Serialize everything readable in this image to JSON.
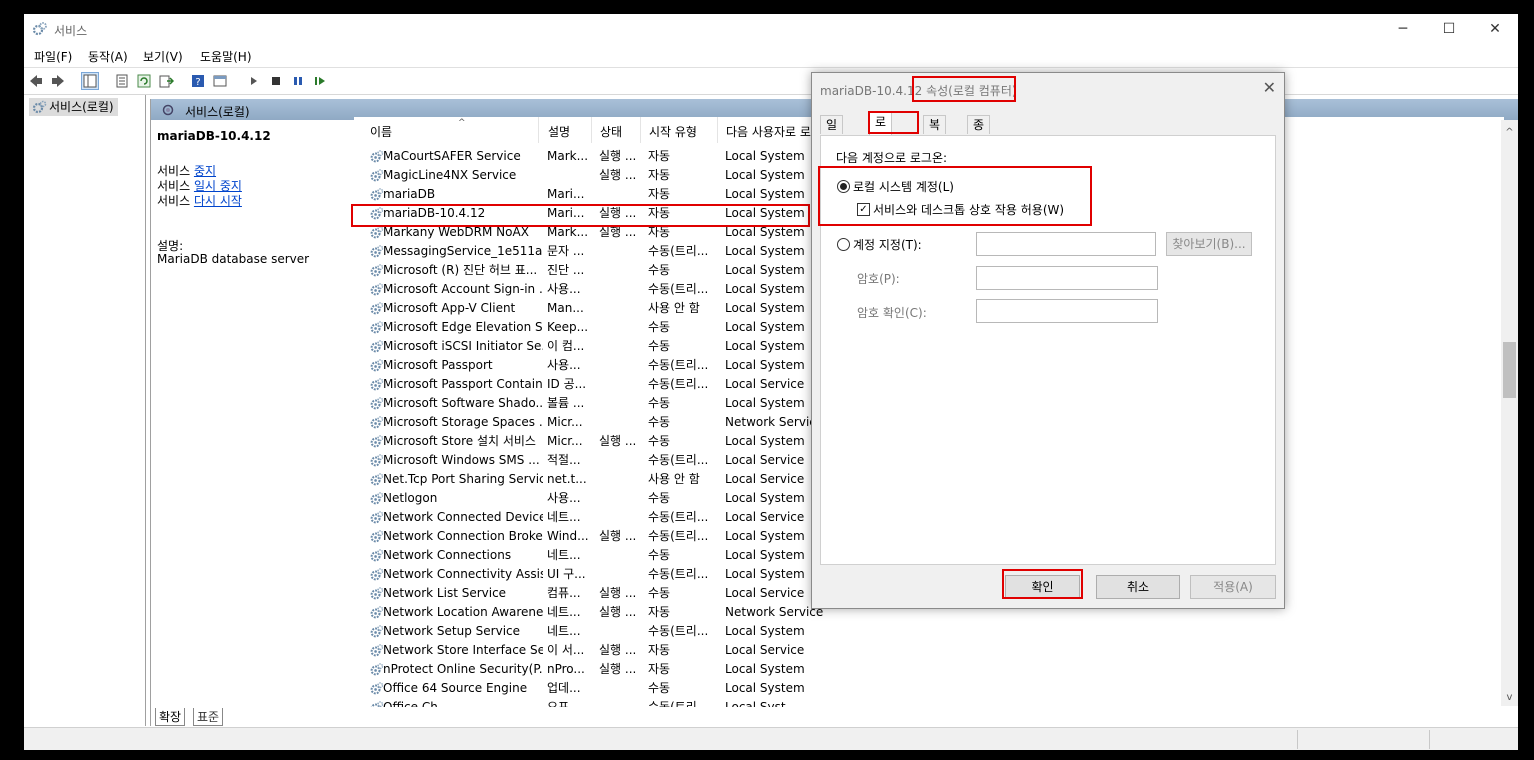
{
  "window": {
    "title": "서비스",
    "min": "─",
    "max": "☐",
    "close": "✕"
  },
  "menu": [
    "파일(F)",
    "동작(A)",
    "보기(V)",
    "도움말(H)"
  ],
  "tree": {
    "root": "서비스(로컬)"
  },
  "pane": {
    "header": "서비스(로컬)",
    "selected_name": "mariaDB-10.4.12",
    "actions": [
      {
        "prefix": "서비스 ",
        "link": "중지"
      },
      {
        "prefix": "서비스 ",
        "link": "일시 중지"
      },
      {
        "prefix": "서비스 ",
        "link": "다시 시작"
      }
    ],
    "desc_label": "설명:",
    "desc_text": "MariaDB database server"
  },
  "columns": [
    "이름",
    "설명",
    "상태",
    "시작 유형",
    "다음 사용자로 로"
  ],
  "services": [
    [
      "MaCourtSAFER Service",
      "Mark...",
      "실행 ...",
      "자동",
      "Local System"
    ],
    [
      "MagicLine4NX Service",
      "",
      "실행 ...",
      "자동",
      "Local System"
    ],
    [
      "mariaDB",
      "Mari...",
      "",
      "자동",
      "Local System"
    ],
    [
      "mariaDB-10.4.12",
      "Mari...",
      "실행 ...",
      "자동",
      "Local System"
    ],
    [
      "Markany WebDRM NoAX",
      "Mark...",
      "실행 ...",
      "자동",
      "Local System"
    ],
    [
      "MessagingService_1e511a",
      "문자 ...",
      "",
      "수동(트리...",
      "Local System"
    ],
    [
      "Microsoft (R) 진단 허브 표...",
      "진단 ...",
      "",
      "수동",
      "Local System"
    ],
    [
      "Microsoft Account Sign-in ...",
      "사용...",
      "",
      "수동(트리...",
      "Local System"
    ],
    [
      "Microsoft App-V Client",
      "Man...",
      "",
      "사용 안 함",
      "Local System"
    ],
    [
      "Microsoft Edge Elevation S...",
      "Keep...",
      "",
      "수동",
      "Local System"
    ],
    [
      "Microsoft iSCSI Initiator Se...",
      "이 컴...",
      "",
      "수동",
      "Local System"
    ],
    [
      "Microsoft Passport",
      "사용...",
      "",
      "수동(트리...",
      "Local System"
    ],
    [
      "Microsoft Passport Container",
      "ID 공...",
      "",
      "수동(트리...",
      "Local Service"
    ],
    [
      "Microsoft Software Shado...",
      "볼륨 ...",
      "",
      "수동",
      "Local System"
    ],
    [
      "Microsoft Storage Spaces ...",
      "Micr...",
      "",
      "수동",
      "Network Service"
    ],
    [
      "Microsoft Store 설치 서비스",
      "Micr...",
      "실행 ...",
      "수동",
      "Local System"
    ],
    [
      "Microsoft Windows SMS ...",
      "적절...",
      "",
      "수동(트리...",
      "Local Service"
    ],
    [
      "Net.Tcp Port Sharing Service",
      "net.t...",
      "",
      "사용 안 함",
      "Local Service"
    ],
    [
      "Netlogon",
      "사용...",
      "",
      "수동",
      "Local System"
    ],
    [
      "Network Connected Device...",
      "네트...",
      "",
      "수동(트리...",
      "Local Service"
    ],
    [
      "Network Connection Broker",
      "Wind...",
      "실행 ...",
      "수동(트리...",
      "Local System"
    ],
    [
      "Network Connections",
      "네트...",
      "",
      "수동",
      "Local System"
    ],
    [
      "Network Connectivity Assis...",
      "UI 구...",
      "",
      "수동(트리...",
      "Local System"
    ],
    [
      "Network List Service",
      "컴퓨...",
      "실행 ...",
      "수동",
      "Local Service"
    ],
    [
      "Network Location Awareness",
      "네트...",
      "실행 ...",
      "자동",
      "Network Service"
    ],
    [
      "Network Setup Service",
      "네트...",
      "",
      "수동(트리...",
      "Local System"
    ],
    [
      "Network Store Interface Se...",
      "이 서...",
      "실행 ...",
      "자동",
      "Local Service"
    ],
    [
      "nProtect Online Security(P...",
      "nPro...",
      "실행 ...",
      "자동",
      "Local System"
    ],
    [
      "Office 64 Source Engine",
      "업데...",
      "",
      "수동",
      "Local System"
    ],
    [
      "Office  Ch...",
      "오프...",
      "",
      "수동(트리...",
      "Local Syst..."
    ]
  ],
  "bottom_tabs": [
    "확장",
    "표준"
  ],
  "dialog": {
    "title_prefix": "mariaDB-10.4.12 ",
    "title_suffix": "속성(로컬 컴퓨터)",
    "close": "✕",
    "tabs": [
      "일반",
      "로그온",
      "복구",
      "종속성"
    ],
    "logon_as": "다음 계정으로 로그온:",
    "local_system": "로컬 시스템 계정(L)",
    "allow_desktop": "서비스와 데스크톱 상호 작용 허용(W)",
    "this_account": "계정 지정(T):",
    "browse": "찾아보기(B)...",
    "password": "암호(P):",
    "confirm_password": "암호 확인(C):",
    "ok": "확인",
    "cancel": "취소",
    "apply": "적용(A)"
  },
  "colors": {
    "highlight": "#e00000",
    "pane_header": "#9fb7cf",
    "link": "#0044cc"
  }
}
